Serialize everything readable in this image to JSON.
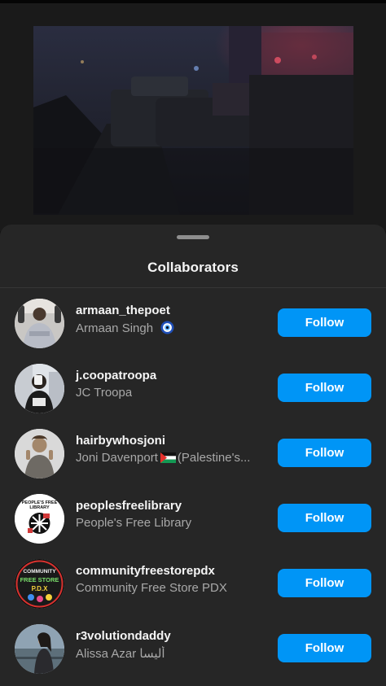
{
  "sheet": {
    "title": "Collaborators"
  },
  "collaborators": [
    {
      "username": "armaan_thepoet",
      "name": "Armaan Singh",
      "follow_label": "Follow"
    },
    {
      "username": "j.coopatroopa",
      "name": "JC Troopa",
      "follow_label": "Follow"
    },
    {
      "username": "hairbywhosjoni",
      "name_prefix": "Joni Davenport",
      "name_suffix": "(Palestine's...",
      "follow_label": "Follow"
    },
    {
      "username": "peoplesfreelibrary",
      "name": "People's Free Library",
      "follow_label": "Follow"
    },
    {
      "username": "communityfreestorepdx",
      "name": "Community Free Store PDX",
      "follow_label": "Follow"
    },
    {
      "username": "r3volutiondaddy",
      "name": "Alissa Azar ألیسا",
      "follow_label": "Follow"
    }
  ],
  "avatar_text": {
    "library_line1": "PEOPLE'S FREE",
    "library_line2": "LIBRARY",
    "store_line1": "COMMUNITY",
    "store_line2": "FREE STORE",
    "store_line3": "P.D.X"
  },
  "colors": {
    "follow_button": "#0095f6",
    "sheet_background": "#262626",
    "primary_text": "#f5f5f5",
    "secondary_text": "#a8a8a8"
  },
  "icons": [
    "evil-eye-emoji",
    "palestine-flag-emoji"
  ]
}
